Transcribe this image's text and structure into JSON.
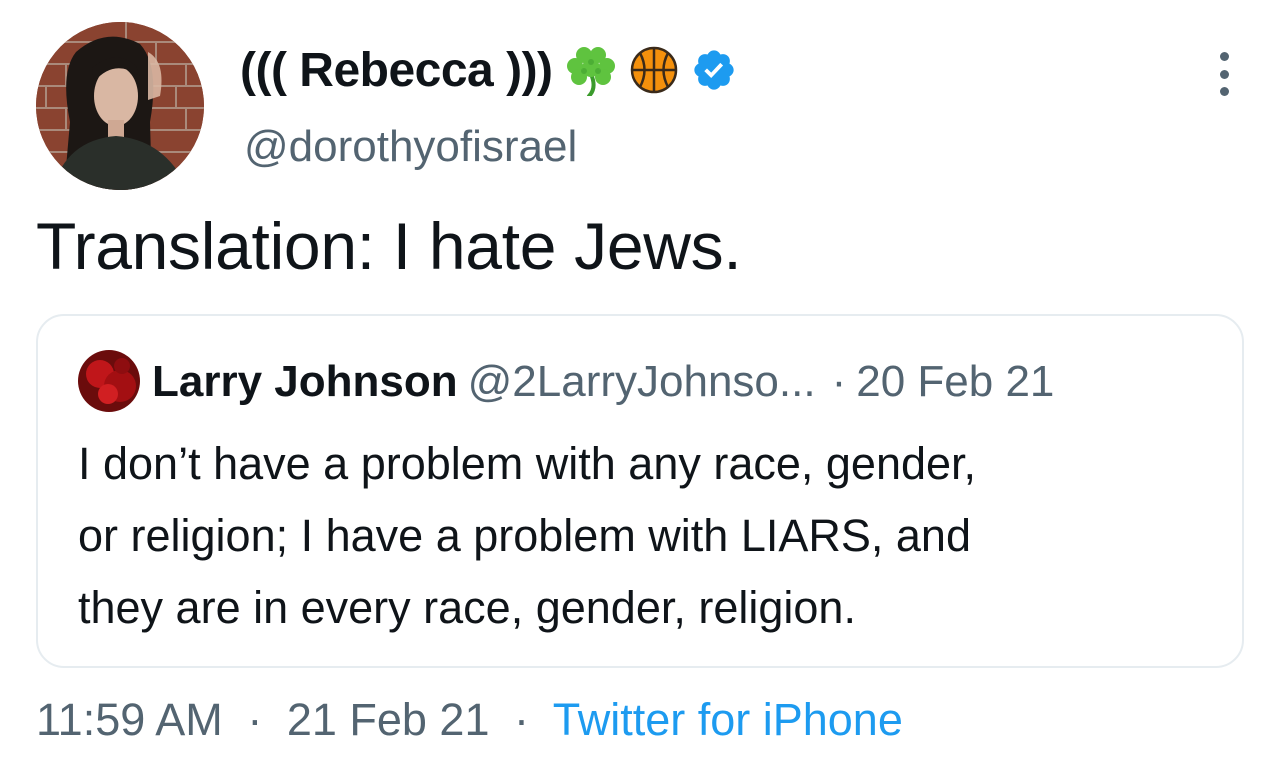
{
  "author": {
    "display_name": "((( Rebecca )))",
    "handle": "@dorothyofisrael",
    "name_emojis": [
      "shamrock-icon",
      "basketball-icon"
    ],
    "verified": true
  },
  "tweet": {
    "text": "Translation: I hate Jews."
  },
  "quoted_tweet": {
    "author_name": "Larry Johnson",
    "author_handle": "@2LarryJohnso...",
    "separator": "·",
    "date": "20 Feb 21",
    "text_lines": [
      "I don’t have a problem with any race, gender,",
      "or religion; I have a problem with LIARS, and",
      "they are in every race, gender, religion."
    ]
  },
  "meta": {
    "time": "11:59 AM",
    "separator": "·",
    "date": "21 Feb 21",
    "source": "Twitter for iPhone"
  },
  "colors": {
    "text_primary": "#0f1419",
    "text_secondary": "#536471",
    "link": "#1d9bf0",
    "verified_badge": "#1d9bf0",
    "border": "#e6ecf0"
  }
}
